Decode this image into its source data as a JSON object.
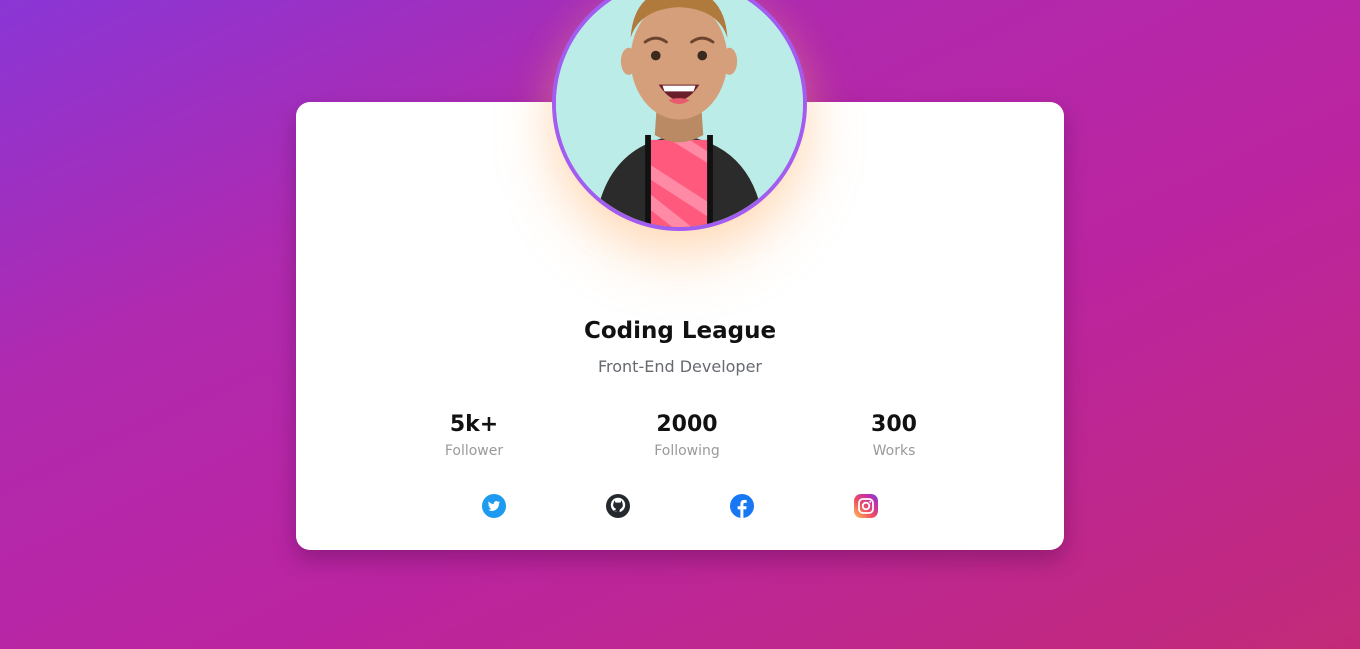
{
  "profile": {
    "name": "Coding League",
    "role": "Front-End Developer"
  },
  "stats": [
    {
      "value": "5k+",
      "label": "Follower"
    },
    {
      "value": "2000",
      "label": "Following"
    },
    {
      "value": "300",
      "label": "Works"
    }
  ],
  "social": [
    {
      "icon": "twitter-icon",
      "color": "#1d9bf0"
    },
    {
      "icon": "github-icon",
      "color": "#24292f"
    },
    {
      "icon": "facebook-icon",
      "color": "#1877f2"
    },
    {
      "icon": "instagram-icon",
      "color": "#e1306c"
    }
  ],
  "colors": {
    "avatar_border": "#a35cf0",
    "avatar_background": "#bcece8",
    "card_background": "#ffffff"
  }
}
